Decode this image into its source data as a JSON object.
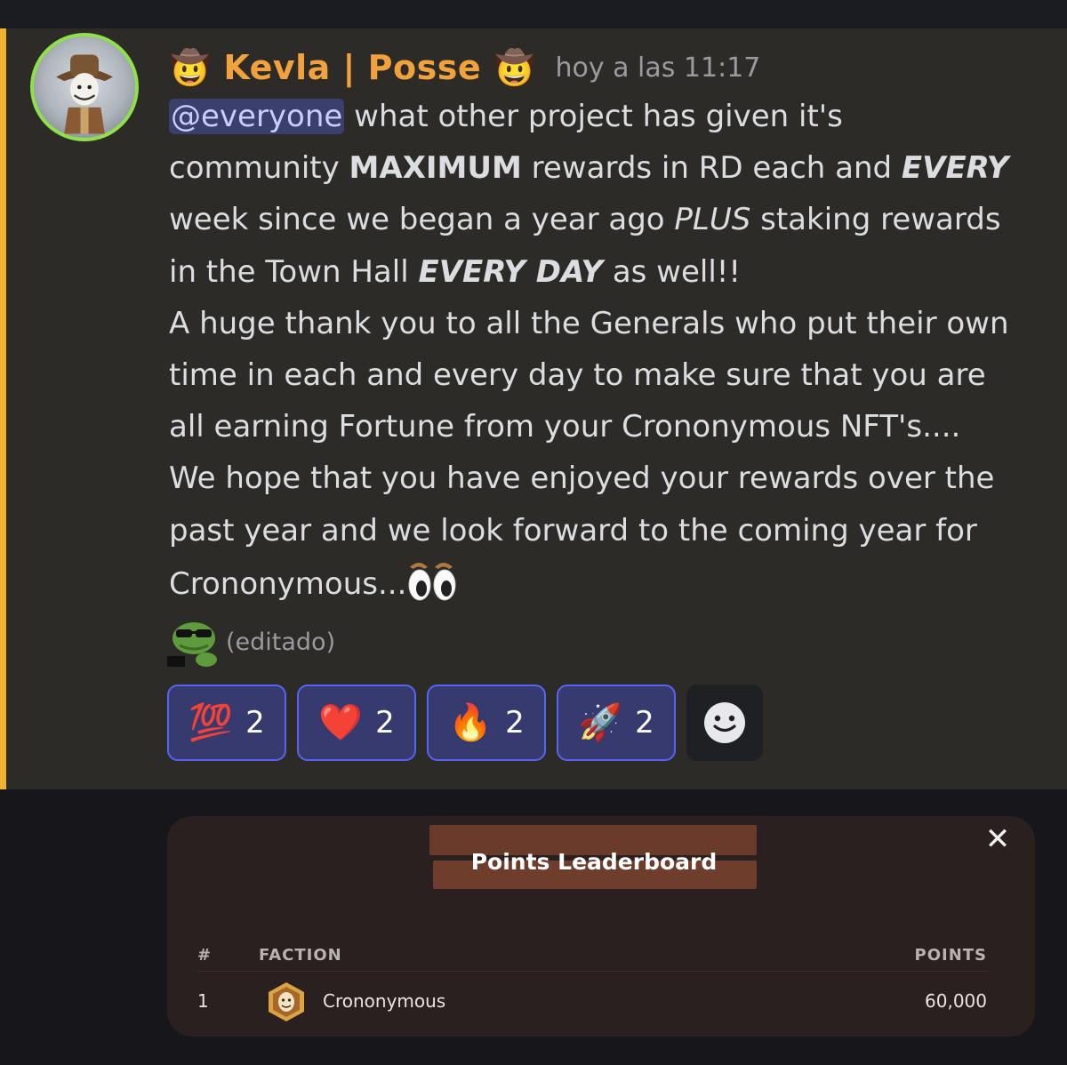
{
  "message": {
    "username": "Kevla | Posse",
    "username_prefix_emoji": "🤠",
    "username_suffix_emoji": "🤠",
    "timestamp": "hoy a las 11:17",
    "mention": "@everyone",
    "lines": [
      {
        "parts": [
          {
            "t": " what other project has given it's",
            "s": "n"
          }
        ]
      },
      {
        "parts": [
          {
            "t": "community ",
            "s": "n"
          },
          {
            "t": "MAXIMUM",
            "s": "b"
          },
          {
            "t": " rewards in RD each and ",
            "s": "n"
          },
          {
            "t": "EVERY",
            "s": "bi"
          }
        ]
      },
      {
        "parts": [
          {
            "t": "week since we began a year ago ",
            "s": "n"
          },
          {
            "t": "PLUS",
            "s": "i"
          },
          {
            "t": " staking rewards",
            "s": "n"
          }
        ]
      },
      {
        "parts": [
          {
            "t": "in the Town Hall ",
            "s": "n"
          },
          {
            "t": "EVERY DAY",
            "s": "bi"
          },
          {
            "t": " as well!!",
            "s": "n"
          }
        ]
      },
      {
        "parts": [
          {
            "t": "A huge thank you to all the Generals who put their own",
            "s": "n"
          }
        ]
      },
      {
        "parts": [
          {
            "t": "time in each and every day to make sure that you are",
            "s": "n"
          }
        ]
      },
      {
        "parts": [
          {
            "t": "all earning Fortune from your Crononymous NFT's....",
            "s": "n"
          }
        ]
      },
      {
        "parts": [
          {
            "t": "We hope that you have enjoyed your rewards over the",
            "s": "n"
          }
        ]
      },
      {
        "parts": [
          {
            "t": "past year and we look forward to the coming year for",
            "s": "n"
          }
        ]
      },
      {
        "parts": [
          {
            "t": "Crononymous...",
            "s": "n"
          }
        ]
      }
    ],
    "trailing_icon": "cowboy-eyes-emoji",
    "edited_icon": "pepe-sunglasses-emoji",
    "edited_label": "(editado)"
  },
  "reactions": [
    {
      "emoji": "💯",
      "count": "2",
      "name": "hundred-points"
    },
    {
      "emoji": "❤️",
      "count": "2",
      "name": "red-heart"
    },
    {
      "emoji": "🔥",
      "count": "2",
      "name": "fire"
    },
    {
      "emoji": "🚀",
      "count": "2",
      "name": "rocket"
    }
  ],
  "add_reaction_icon": "smiley-add-reaction-icon",
  "colors": {
    "username": "#f2a23c",
    "mention_bar": "#f0b232",
    "reaction_border": "#5865f2"
  },
  "leaderboard": {
    "title": "Points Leaderboard",
    "close_icon": "✕",
    "headers": {
      "rank": "#",
      "faction": "FACTION",
      "points": "POINTS"
    },
    "rows": [
      {
        "rank": "1",
        "faction": "Crononymous",
        "points": "60,000",
        "icon": "crononymous-mask-badge"
      }
    ]
  }
}
